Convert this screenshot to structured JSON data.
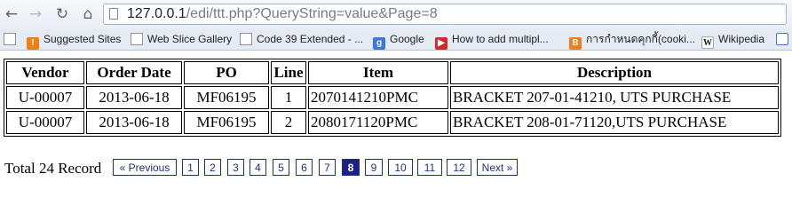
{
  "browser": {
    "url_host": "127.0.0.1",
    "url_path": "/edi/ttt.php?QueryString=value&Page=8",
    "bookmarks": [
      {
        "label": "Suggested Sites",
        "icon": "suggested-sites-icon"
      },
      {
        "label": "Web Slice Gallery",
        "icon": "page-icon"
      },
      {
        "label": "Code 39 Extended - ...",
        "icon": "page-icon"
      },
      {
        "label": "Google",
        "icon": "google-icon"
      },
      {
        "label": "How to add multipl...",
        "icon": "youtube-icon"
      },
      {
        "label": "การกำหนดคุกกี้(cooki...",
        "icon": "blogger-icon"
      },
      {
        "label": "Wikipedia",
        "icon": "wikipedia-icon"
      }
    ]
  },
  "table": {
    "headers": [
      "Vendor",
      "Order Date",
      "PO",
      "Line",
      "Item",
      "Description"
    ],
    "rows": [
      [
        "U-00007",
        "2013-06-18",
        "MF06195",
        "1",
        "2070141210PMC",
        "BRACKET 207-01-41210, UTS PURCHASE"
      ],
      [
        "U-00007",
        "2013-06-18",
        "MF06195",
        "2",
        "2080171120PMC",
        "BRACKET 208-01-71120,UTS PURCHASE"
      ]
    ]
  },
  "pager": {
    "total_text": "Total 24 Record",
    "prev_label": "« Previous",
    "next_label": "Next »",
    "pages": [
      "1",
      "2",
      "3",
      "4",
      "5",
      "6",
      "7",
      "8",
      "9",
      "10",
      "11",
      "12"
    ],
    "current_page": "8"
  },
  "colors": {
    "link": "#1f2e8a",
    "current_page_bg": "#1f1f8a"
  }
}
